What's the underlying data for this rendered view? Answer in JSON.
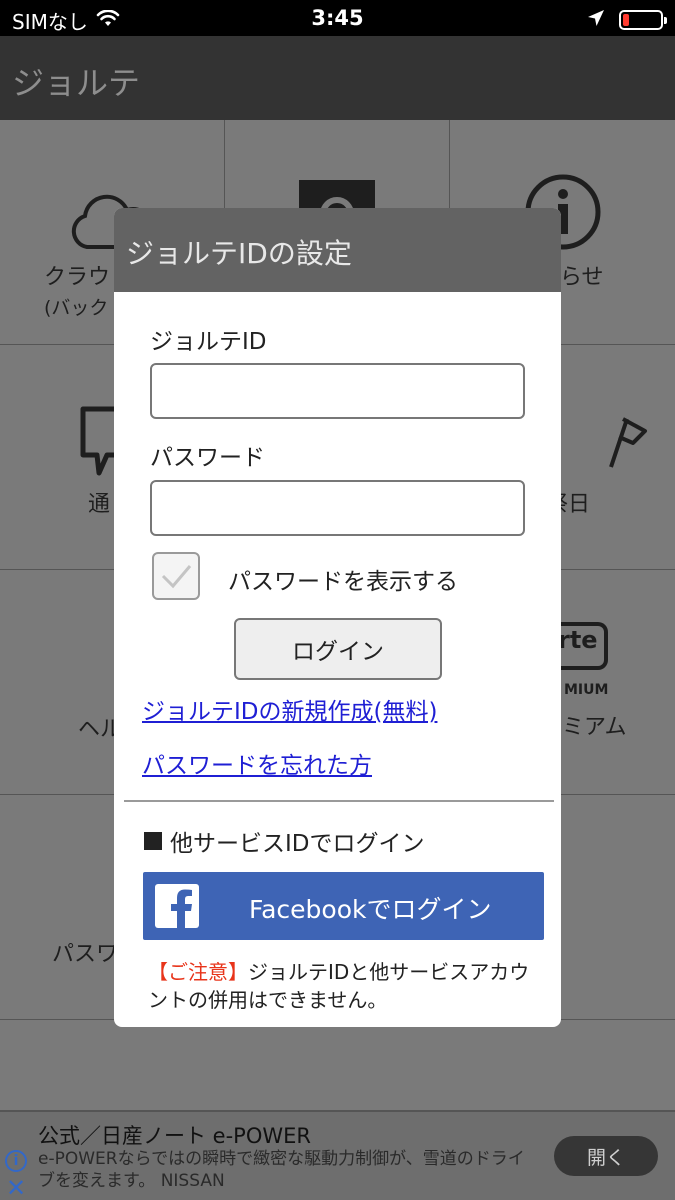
{
  "status": {
    "carrier": "SIMなし",
    "time": "3:45"
  },
  "app": {
    "title": "ジョルテ"
  },
  "grid": {
    "cloud_label_line1": "クラウ",
    "cloud_label_line2": "(バック",
    "info_label": "らせ",
    "notify_label": "通",
    "holiday_label": "祭日",
    "help_label": "ヘル",
    "premium_label": "ミアム",
    "premium_logo_text": "rte",
    "premium_sub_text": "MIUM",
    "password_label": "パスワ"
  },
  "modal": {
    "title": "ジョルテIDの設定",
    "id_label": "ジョルテID",
    "id_value": "",
    "password_label": "パスワード",
    "password_value": "",
    "show_password_label": "パスワードを表示する",
    "login_button": "ログイン",
    "create_link": "ジョルテIDの新規作成(無料)",
    "forgot_link": "パスワードを忘れた方",
    "other_login_label": "他サービスIDでログイン",
    "facebook_button": "Facebookでログイン",
    "facebook_logo": "f",
    "notice_warn": "【ご注意】",
    "notice_text": "ジョルテIDと他サービスアカウントの併用はできません。"
  },
  "ad": {
    "title": "公式／日産ノート e-POWER",
    "description": "e-POWERならではの瞬時で緻密な駆動力制御が、雪道のドライブを変えます。 NISSAN",
    "open_button": "開く",
    "info_icon": "i",
    "close_icon": "✕"
  },
  "colors": {
    "header_bg": "#333333",
    "modal_header_bg": "#636363",
    "facebook_blue": "#3e64b5",
    "link_blue": "#1f1fd4",
    "warn_red": "#e8341a",
    "battery_red": "#ff3b30"
  },
  "icons": [
    "wifi-icon",
    "location-arrow-icon",
    "battery-icon",
    "cloud-icon",
    "gear-icon",
    "info-icon",
    "speech-bubble-icon",
    "flag-icon",
    "question-icon",
    "lock-icon",
    "check-icon",
    "facebook-icon",
    "close-icon"
  ]
}
